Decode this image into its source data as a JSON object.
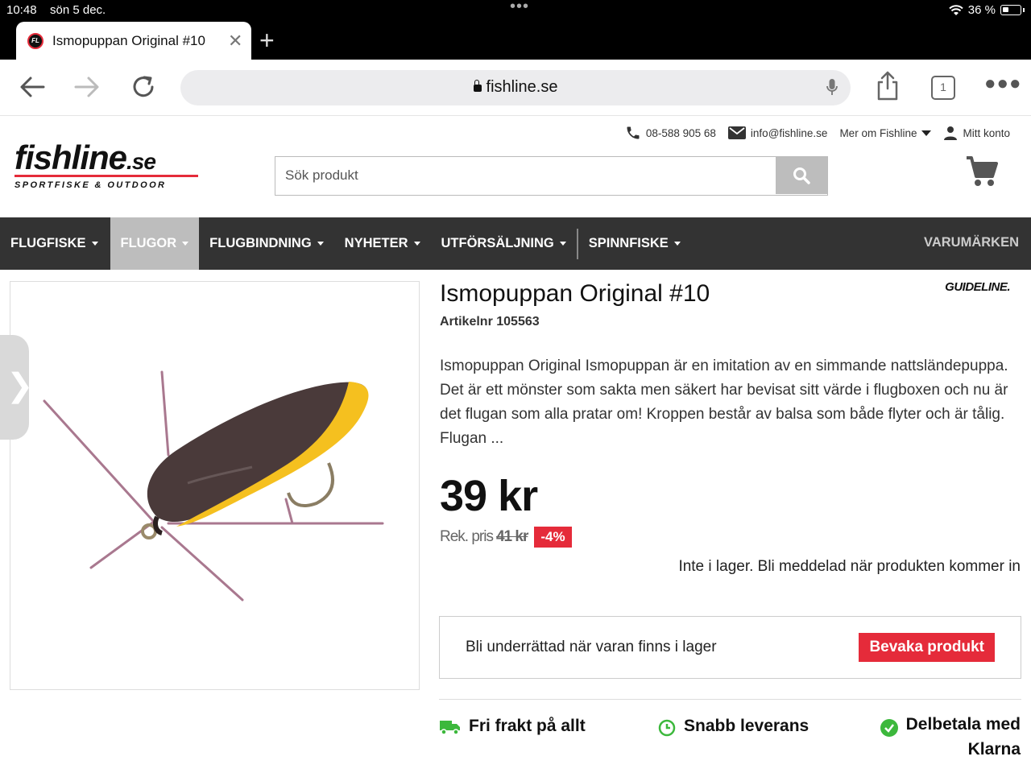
{
  "status": {
    "time": "10:48",
    "date": "sön 5 dec.",
    "battery": "36 %"
  },
  "tab": {
    "favicon_text": "FL",
    "title": "Ismopuppan Original #10"
  },
  "toolbar": {
    "url": "fishline.se",
    "tab_count": "1"
  },
  "header": {
    "phone": "08-588 905 68",
    "email": "info@fishline.se",
    "about": "Mer om Fishline",
    "account": "Mitt konto",
    "logo_main": "fishline",
    "logo_tld": ".se",
    "logo_sub": "SPORTFISKE & OUTDOOR",
    "search_placeholder": "Sök produkt"
  },
  "nav": {
    "items": [
      {
        "label": "FLUGFISKE"
      },
      {
        "label": "FLUGOR"
      },
      {
        "label": "FLUGBINDNING"
      },
      {
        "label": "NYHETER"
      },
      {
        "label": "UTFÖRSÄLJNING"
      },
      {
        "label": "SPINNFISKE"
      }
    ],
    "brands": "VARUMÄRKEN"
  },
  "product": {
    "title": "Ismopuppan Original #10",
    "brand": "GUIDELINE.",
    "artnr": "Artikelnr 105563",
    "description": "Ismopuppan Original Ismopuppan är en imitation av en simmande nattsländepuppa. Det är ett mönster som sakta men säkert har bevisat sitt värde i flugboxen och nu är det flugan som alla pratar om! Kroppen består av balsa som både flyter och är tålig.  Flugan ...",
    "price": "39 kr",
    "rek_label": "Rek. pris",
    "rek_price": "41 kr",
    "discount": "-4%",
    "stock": "Inte i lager. Bli meddelad när produkten kommer in",
    "watch_label": "Bli underrättad när varan finns i lager",
    "watch_button": "Bevaka produkt"
  },
  "usps": {
    "shipping": "Fri frakt på allt",
    "delivery": "Snabb leverans",
    "klarna_line1": "Delbetala med",
    "klarna_line2": "Klarna"
  },
  "colors": {
    "accent": "#e52b3a",
    "nav_bg": "#333333",
    "usp_green": "#3cb83c"
  }
}
